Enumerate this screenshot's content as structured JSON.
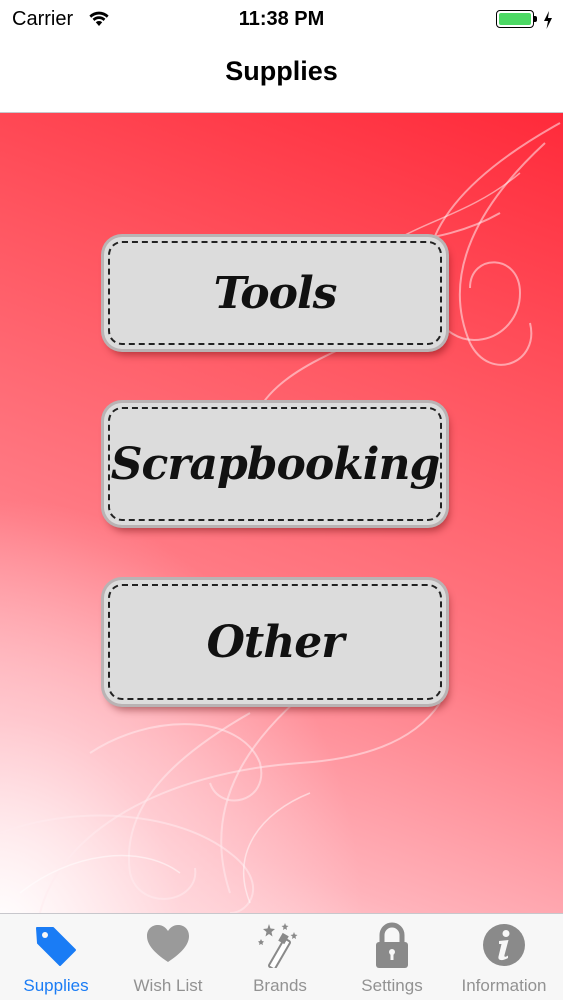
{
  "status_bar": {
    "carrier": "Carrier",
    "time": "11:38 PM",
    "battery_color": "#4cd964"
  },
  "nav": {
    "title": "Supplies"
  },
  "menu": {
    "buttons": [
      {
        "label": "Tools"
      },
      {
        "label": "Scrapbooking"
      },
      {
        "label": "Other"
      }
    ]
  },
  "tab_bar": {
    "active_color": "#1a7cf5",
    "inactive_color": "#929292",
    "tabs": [
      {
        "label": "Supplies",
        "icon": "tag-icon",
        "active": true
      },
      {
        "label": "Wish List",
        "icon": "heart-icon",
        "active": false
      },
      {
        "label": "Brands",
        "icon": "magic-wand-icon",
        "active": false
      },
      {
        "label": "Settings",
        "icon": "lock-icon",
        "active": false
      },
      {
        "label": "Information",
        "icon": "info-icon",
        "active": false
      }
    ]
  }
}
